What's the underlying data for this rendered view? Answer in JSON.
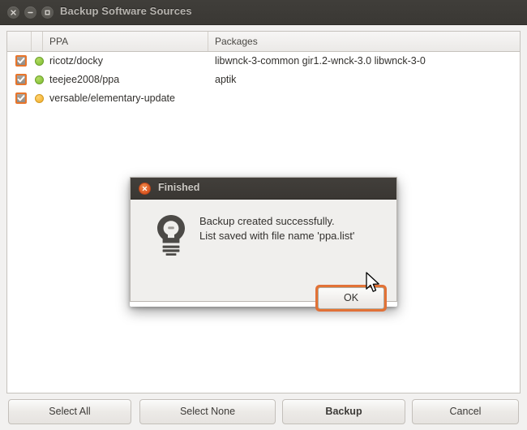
{
  "window": {
    "title": "Backup Software Sources",
    "controls": [
      {
        "name": "close",
        "glyph": "×"
      },
      {
        "name": "minimize",
        "glyph": "−"
      },
      {
        "name": "maximize",
        "glyph": "□"
      }
    ]
  },
  "list": {
    "columns": [
      "",
      "",
      "PPA",
      "Packages"
    ],
    "rows": [
      {
        "checked": true,
        "status": "green",
        "ppa": "ricotz/docky",
        "packages": "libwnck-3-common gir1.2-wnck-3.0 libwnck-3-0"
      },
      {
        "checked": true,
        "status": "green",
        "ppa": "teejee2008/ppa",
        "packages": "aptik"
      },
      {
        "checked": true,
        "status": "orange",
        "ppa": "versable/elementary-update",
        "packages": ""
      }
    ]
  },
  "buttons": {
    "select_all": "Select All",
    "select_none": "Select None",
    "backup": "Backup",
    "cancel": "Cancel"
  },
  "dialog": {
    "title": "Finished",
    "icon": "lightbulb-icon",
    "message_line1": "Backup created successfully.",
    "message_line2": "List saved with file name 'ppa.list'",
    "ok_label": "OK"
  },
  "colors": {
    "accent_orange": "#e8752b",
    "status_green": "#8cc63f",
    "status_orange": "#f5b73c",
    "titlebar_dark": "#3c3a36",
    "window_bg": "#f2f1f0"
  }
}
